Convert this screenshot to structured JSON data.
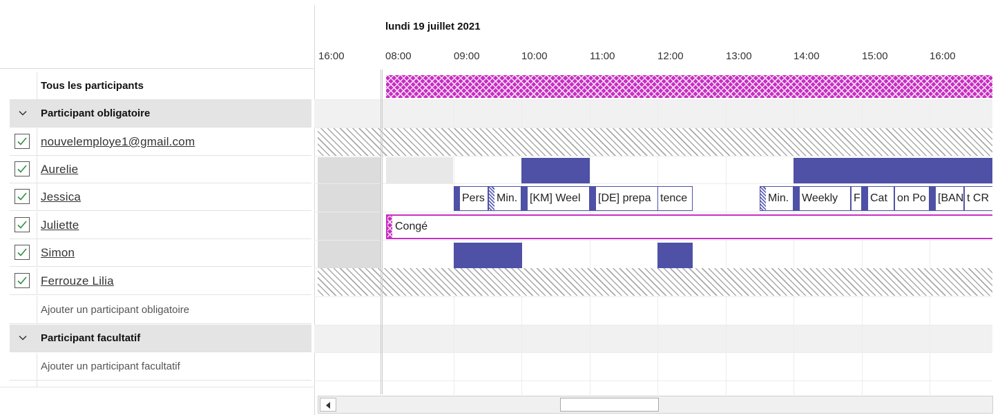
{
  "participants_panel": {
    "all_label": "Tous les participants",
    "required_group": "Participant obligatoire",
    "required": [
      {
        "name": "nouvelemploye1@gmail.com",
        "checked": true
      },
      {
        "name": "Aurelie",
        "checked": true
      },
      {
        "name": "Jessica",
        "checked": true
      },
      {
        "name": "Juliette",
        "checked": true
      },
      {
        "name": "Simon",
        "checked": true
      },
      {
        "name": "Ferrouze Lilia",
        "checked": true
      }
    ],
    "add_required": "Ajouter un participant obligatoire",
    "optional_group": "Participant facultatif",
    "add_optional": "Ajouter un participant facultatif"
  },
  "timeline": {
    "date": "lundi 19 juillet 2021",
    "hours": [
      "16:00",
      "08:00",
      "09:00",
      "10:00",
      "11:00",
      "12:00",
      "13:00",
      "14:00",
      "15:00",
      "16:00"
    ],
    "events": {
      "jessica": [
        "Pers",
        "Min.",
        "[KM] Weel",
        "[DE] prepa",
        "tence",
        "Min.",
        "Weekly",
        "F",
        "Cat",
        "on Po",
        "[BAN",
        "t CR"
      ],
      "juliette": [
        "Congé"
      ]
    }
  },
  "colors": {
    "busy": "#4e51a6",
    "out_of_office": "#c62fc1",
    "checkbox": "#2e8b3c"
  },
  "icons": {
    "group_toggle": "chevron-down-icon",
    "participant_check": "checkbox-checked-icon",
    "scroll_left": "arrow-left-icon"
  }
}
